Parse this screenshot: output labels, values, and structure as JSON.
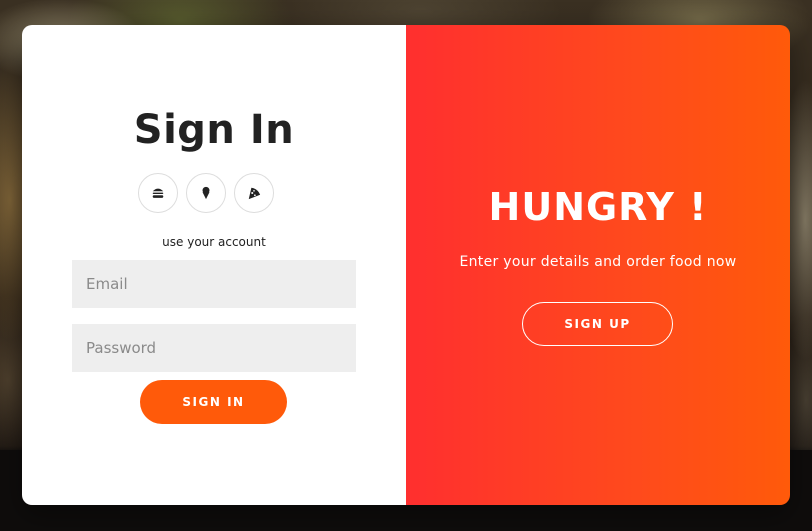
{
  "signin": {
    "title": "Sign In",
    "social_icons": [
      "burger-icon",
      "ice-cream-icon",
      "pizza-icon"
    ],
    "hint": "use your account",
    "email_placeholder": "Email",
    "password_placeholder": "Password",
    "button_label": "SIGN IN"
  },
  "signup": {
    "title": "HUNGRY !",
    "subtitle": "Enter your details and order food now",
    "button_label": "SIGN UP"
  },
  "colors": {
    "accent": "#ff5a0a",
    "gradient_start": "#ff2f2f",
    "gradient_end": "#ff5a0a",
    "input_bg": "#eeeeee",
    "title_text": "#222222"
  }
}
